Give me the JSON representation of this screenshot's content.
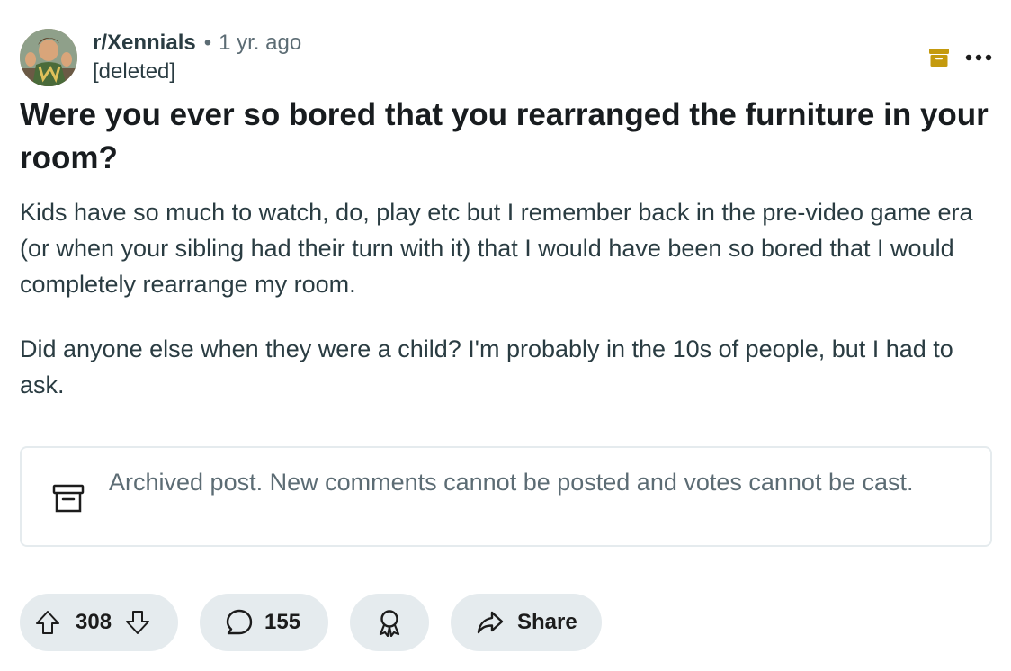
{
  "post": {
    "subreddit": "r/Xennials",
    "separator": "•",
    "age": "1 yr. ago",
    "author": "[deleted]",
    "title": "Were you ever so bored that you rearranged the furniture in your room?",
    "body": [
      "Kids have so much to watch, do, play etc but I remember back in the pre-video game era (or when your sibling had their turn with it) that I would have been so bored that I would completely rearrange my room.",
      "Did anyone else when they were a child? I'm probably in the 10s of people, but I had to ask."
    ],
    "archived_notice": "Archived post. New comments cannot be posted and votes cannot be cast."
  },
  "actions": {
    "vote_count": "308",
    "comment_count": "155",
    "share_label": "Share"
  },
  "icons": {
    "archive_badge": "archive-icon",
    "more": "ellipsis-icon",
    "notice": "archive-box-icon",
    "upvote": "upvote-arrow-icon",
    "downvote": "downvote-arrow-icon",
    "comment": "comment-bubble-icon",
    "award": "award-icon",
    "share": "share-arrow-icon"
  },
  "colors": {
    "archive_accent": "#c49a0e",
    "pill_background": "#e5ebee",
    "muted_text": "#5c6c74"
  }
}
